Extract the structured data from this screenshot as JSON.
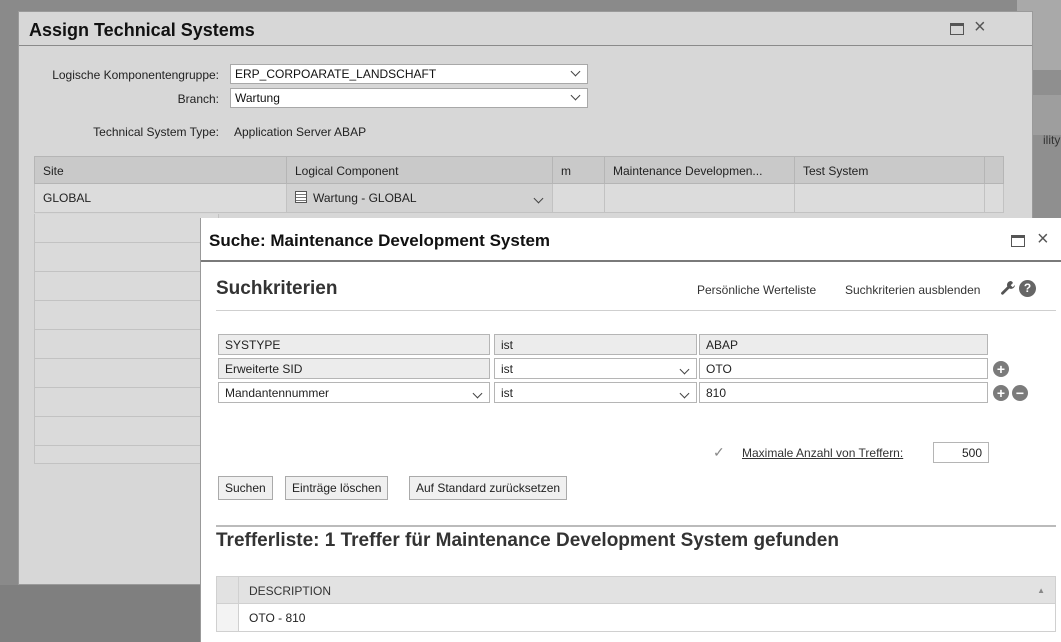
{
  "background": {
    "partial_text": "ility"
  },
  "dialog1": {
    "title": "Assign Technical Systems",
    "form": {
      "component_group_label": "Logische Komponentengruppe:",
      "component_group_value": "ERP_CORPOARATE_LANDSCHAFT",
      "branch_label": "Branch:",
      "branch_value": "Wartung",
      "system_type_label": "Technical System Type:",
      "system_type_value": "Application Server ABAP"
    },
    "table": {
      "columns": [
        "Site",
        "Logical Component",
        "m",
        "Maintenance Developmen...",
        "Test System"
      ],
      "rows": [
        {
          "site": "GLOBAL",
          "logical_component": "Wartung - GLOBAL"
        }
      ]
    }
  },
  "dialog2": {
    "title": "Suche: Maintenance Development System",
    "criteria_heading": "Suchkriterien",
    "links": {
      "personal_list": "Persönliche Werteliste",
      "hide_criteria": "Suchkriterien ausblenden"
    },
    "criteria": [
      {
        "field": "SYSTYPE",
        "operator": "ist",
        "value": "ABAP"
      },
      {
        "field": "Erweiterte SID",
        "operator": "ist",
        "value": "OTO"
      },
      {
        "field": "Mandantennummer",
        "operator": "ist",
        "value": "810"
      }
    ],
    "max_hits_label": "Maximale Anzahl von Treffern:",
    "max_hits_value": "500",
    "max_hits_checked": true,
    "buttons": {
      "search": "Suchen",
      "clear": "Einträge löschen",
      "reset": "Auf Standard zurücksetzen"
    },
    "result_heading": "Trefferliste: 1 Treffer für Maintenance Development System gefunden",
    "result_table": {
      "column": "DESCRIPTION",
      "rows": [
        "OTO - 810"
      ]
    }
  },
  "icons": [
    "maximize-icon",
    "close-icon",
    "wrench-icon",
    "help-icon",
    "plus-icon",
    "minus-icon",
    "chevron-down-icon",
    "checkbox-icon",
    "logical-component-icon"
  ]
}
